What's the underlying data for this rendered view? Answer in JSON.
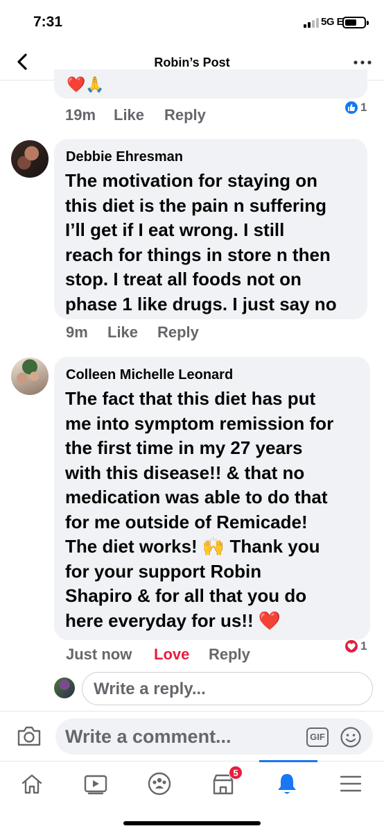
{
  "status_bar": {
    "time": "7:31",
    "network": "5G E"
  },
  "nav": {
    "title": "Robin’s Post"
  },
  "previous_comment": {
    "emoji": "❤️🙏",
    "time": "19m",
    "like_label": "Like",
    "reply_label": "Reply",
    "reaction": {
      "icon": "like-thumb-icon",
      "count": "1",
      "color": "#1877f2"
    }
  },
  "comments": [
    {
      "author": "Debbie Ehresman",
      "lines": [
        "The motivation for staying on",
        "this diet is the pain n suffering",
        "I’ll get if I eat wrong. I still",
        "reach for things in store n then",
        "stop. I treat all foods not on",
        "phase 1 like drugs. I just say no"
      ],
      "time": "9m",
      "like_label": "Like",
      "reply_label": "Reply"
    },
    {
      "author": "Colleen Michelle Leonard",
      "lines": [
        "The fact that this diet has put",
        "me into symptom remission for",
        "the first time in my 27 years",
        "with this disease!! & that no",
        "medication was able to do that",
        "for me outside of Remicade!"
      ],
      "line7_before": "The diet works! ",
      "line7_emoji": "🙌",
      "line7_after": " Thank you",
      "line8_before": "for your support ",
      "mention_part1": "Robin",
      "mention_part2": "Shapiro",
      "line9_after": " & for all that you do",
      "line10_before": "here everyday for us!! ",
      "line10_emoji": "❤️",
      "time": "Just now",
      "love_label": "Love",
      "reply_label": "Reply",
      "reaction": {
        "icon": "love-heart-icon",
        "count": "1",
        "color": "#e41e3f"
      }
    }
  ],
  "reply_box": {
    "placeholder": "Write a reply..."
  },
  "comment_box": {
    "placeholder": "Write a comment...",
    "gif_label": "GIF"
  },
  "tab_bar": {
    "tabs": [
      "home-icon",
      "watch-icon",
      "groups-icon",
      "marketplace-icon",
      "notifications-icon",
      "menu-icon"
    ],
    "active": "notifications-icon",
    "marketplace_badge": "5"
  },
  "colors": {
    "accent": "#1877f2",
    "love": "#e41e3f",
    "bubble": "#f0f2f5",
    "meta_text": "#65676b"
  }
}
